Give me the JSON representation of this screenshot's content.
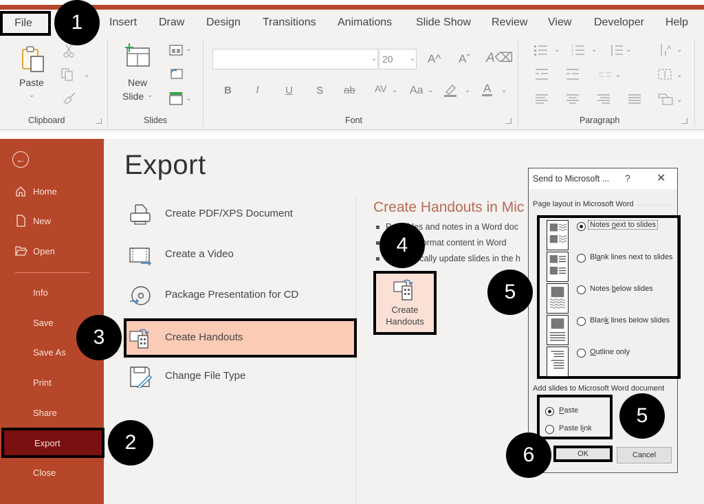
{
  "ribbon": {
    "accent_color": "#b7472a",
    "file_tab": "File",
    "tabs": [
      "Insert",
      "Draw",
      "Design",
      "Transitions",
      "Animations",
      "Slide Show",
      "Review",
      "View",
      "Developer",
      "Help"
    ],
    "groups": {
      "clipboard": {
        "label": "Clipboard",
        "paste_label": "Paste"
      },
      "slides": {
        "label": "Slides",
        "new_slide_line1": "New",
        "new_slide_line2": "Slide"
      },
      "font": {
        "label": "Font",
        "font_name_value": "",
        "font_size_value": "20"
      },
      "paragraph": {
        "label": "Paragraph"
      }
    },
    "icons": {
      "paste": "clipboard-icon",
      "cut": "scissors-icon",
      "copy": "copy-icon",
      "format_painter": "brush-icon",
      "new_slide": "new-slide-icon",
      "layout": "layout-icon",
      "reset": "reset-icon",
      "section": "section-icon",
      "grow_font": "A^",
      "shrink_font": "Aˇ",
      "clear_format": "A⌫",
      "bold": "B",
      "italic": "I",
      "underline": "U",
      "shadow": "S",
      "strikethrough": "ab",
      "spacing": "AV",
      "change_case": "Aa",
      "highlight": "highlight-icon",
      "font_color": "A"
    }
  },
  "backstage": {
    "accent_color": "#b7472a",
    "back_icon": "back-arrow-icon",
    "nav": [
      {
        "label": "Home",
        "icon": "home-icon"
      },
      {
        "label": "New",
        "icon": "new-doc-icon"
      },
      {
        "label": "Open",
        "icon": "folder-open-icon"
      },
      {
        "label": "Info"
      },
      {
        "label": "Save"
      },
      {
        "label": "Save As"
      },
      {
        "label": "Print"
      },
      {
        "label": "Share"
      },
      {
        "label": "Export",
        "active": true
      },
      {
        "label": "Close"
      }
    ],
    "title": "Export",
    "options": [
      {
        "label": "Create PDF/XPS Document",
        "icon": "pdf-document-icon"
      },
      {
        "label": "Create a Video",
        "icon": "video-icon"
      },
      {
        "label": "Package Presentation for CD",
        "icon": "cd-icon"
      },
      {
        "label": "Create Handouts",
        "icon": "handouts-icon",
        "active": true
      },
      {
        "label": "Change File Type",
        "icon": "change-file-type-icon"
      }
    ],
    "detail": {
      "title": "Create Handouts in Mic",
      "bullets": [
        "Put slides and notes in a Word doc",
        "Edit and format content in Word",
        "Automatically update slides in the h"
      ],
      "button_line1": "Create",
      "button_line2": "Handouts"
    }
  },
  "dialog": {
    "title": "Send to Microsoft ...",
    "help": "?",
    "close": "✕",
    "layout_section": "Page layout in Microsoft Word",
    "layouts": [
      {
        "pre": "Notes ",
        "u": "n",
        "post": "ext to slides",
        "selected": true
      },
      {
        "pre": "Bl",
        "u": "a",
        "post": "nk lines next to slides",
        "selected": false
      },
      {
        "pre": "Notes ",
        "u": "b",
        "post": "elow slides",
        "selected": false
      },
      {
        "pre": "Blan",
        "u": "k",
        "post": " lines below slides",
        "selected": false
      },
      {
        "pre": "",
        "u": "O",
        "post": "utline only",
        "selected": false
      }
    ],
    "add_section": "Add slides to Microsoft Word document",
    "paste_options": [
      {
        "pre": "",
        "u": "P",
        "post": "aste",
        "selected": true
      },
      {
        "pre": "Paste l",
        "u": "i",
        "post": "nk",
        "selected": false
      }
    ],
    "ok": "OK",
    "cancel": "Cancel"
  },
  "steps": [
    "1",
    "2",
    "3",
    "4",
    "5",
    "5",
    "6"
  ]
}
